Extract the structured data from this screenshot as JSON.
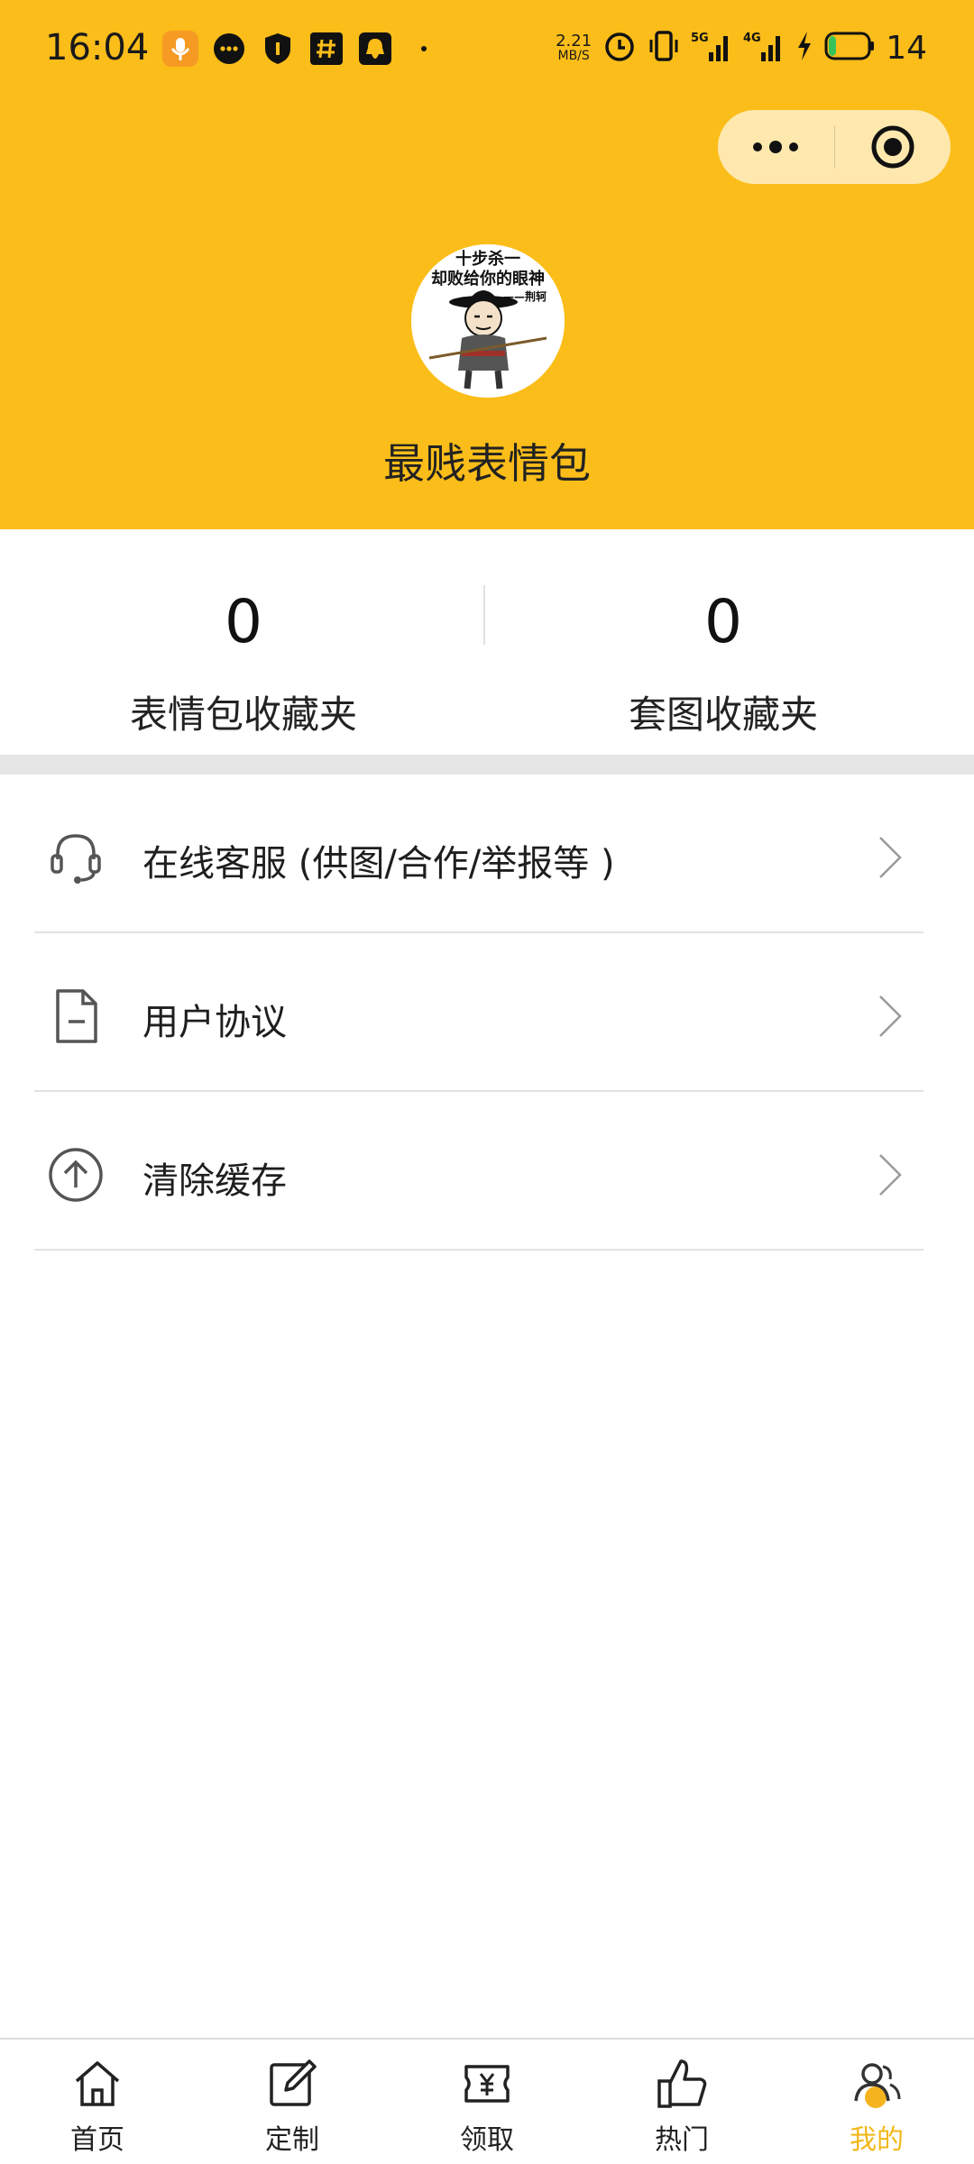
{
  "status_bar": {
    "time": "16:04",
    "net_speed_value": "2.21",
    "net_speed_unit": "MB/S",
    "signal_1": "5G",
    "signal_2": "4G",
    "battery": "14"
  },
  "profile": {
    "avatar_caption_line1": "十步杀一",
    "avatar_caption_line2": "却败给你的眼神",
    "avatar_caption_line3": "——荆轲",
    "name": "最贱表情包"
  },
  "stats": [
    {
      "value": "0",
      "label": "表情包收藏夹"
    },
    {
      "value": "0",
      "label": "套图收藏夹"
    }
  ],
  "menu": [
    {
      "label": "在线客服 (供图/合作/举报等 )",
      "icon": "headset-icon"
    },
    {
      "label": "用户协议",
      "icon": "document-icon"
    },
    {
      "label": "清除缓存",
      "icon": "upload-circle-icon"
    }
  ],
  "tabs": [
    {
      "label": "首页",
      "icon": "home-icon"
    },
    {
      "label": "定制",
      "icon": "edit-icon"
    },
    {
      "label": "领取",
      "icon": "coupon-yuan-icon"
    },
    {
      "label": "热门",
      "icon": "thumbs-up-icon"
    },
    {
      "label": "我的",
      "icon": "user-icon",
      "active": true
    }
  ],
  "colors": {
    "header_bg": "#fbbd19",
    "tab_active": "#f2b81a"
  }
}
